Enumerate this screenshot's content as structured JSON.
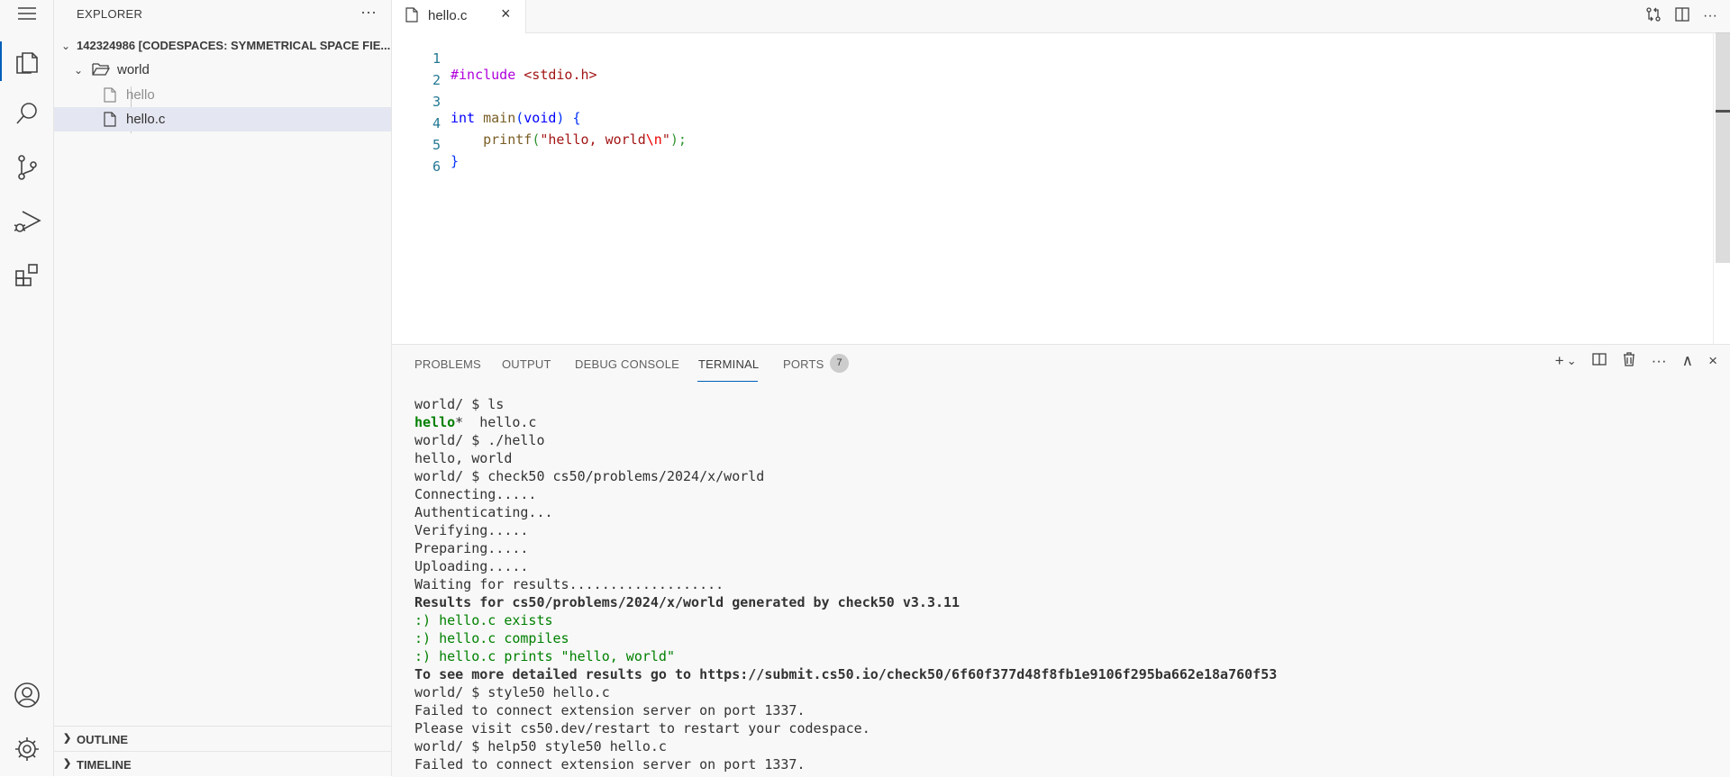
{
  "activity_bar": {
    "items": [
      "menu-icon",
      "explorer-icon",
      "search-icon",
      "source-control-icon",
      "run-debug-icon",
      "extensions-icon",
      "accounts-icon",
      "settings-gear-icon"
    ]
  },
  "sidebar": {
    "title": "EXPLORER",
    "more": "···",
    "root": "142324986 [CODESPACES: SYMMETRICAL SPACE FIE...",
    "folder": "world",
    "files": [
      "hello",
      "hello.c"
    ],
    "outline": "OUTLINE",
    "timeline": "TIMELINE"
  },
  "editor": {
    "tab_label": "hello.c",
    "close": "×",
    "line_numbers": [
      "1",
      "2",
      "3",
      "4",
      "5",
      "6"
    ],
    "code": {
      "l1_directive": "#include",
      "l1_header": " <stdio.h>",
      "l3_int": "int",
      "l3_main": " main",
      "l3_paren_open": "(",
      "l3_void": "void",
      "l3_paren_close": ")",
      "l3_brace": " {",
      "l4_indent": "    ",
      "l4_printf": "printf",
      "l4_open": "(",
      "l4_str1": "\"hello, world",
      "l4_esc": "\\n",
      "l4_str2": "\"",
      "l4_close": ");",
      "l5_brace": "}"
    }
  },
  "panel": {
    "tabs": [
      "PROBLEMS",
      "OUTPUT",
      "DEBUG CONSOLE",
      "TERMINAL",
      "PORTS"
    ],
    "ports_badge": "7",
    "actions": [
      "+",
      "⌄",
      "◫",
      "🗑",
      "···",
      "∧",
      "×"
    ],
    "terminal": {
      "l1": "world/ $ ls",
      "l2a": "hello",
      "l2b": "*  hello.c",
      "l3": "world/ $ ./hello",
      "l4": "hello, world",
      "l5": "world/ $ check50 cs50/problems/2024/x/world",
      "l6": "Connecting.....",
      "l7": "Authenticating...",
      "l8": "Verifying.....",
      "l9": "Preparing.....",
      "l10": "Uploading.....",
      "l11": "Waiting for results...................",
      "l12": "Results for cs50/problems/2024/x/world generated by check50 v3.3.11",
      "l13": ":) hello.c exists",
      "l14": ":) hello.c compiles",
      "l15": ":) hello.c prints \"hello, world\"",
      "l16": "To see more detailed results go to https://submit.cs50.io/check50/6f60f377d48f8fb1e9106f295ba662e18a760f53",
      "l17": "world/ $ style50 hello.c",
      "l18": "Failed to connect extension server on port 1337.",
      "l19": "Please visit cs50.dev/restart to restart your codespace.",
      "l20": "world/ $ help50 style50 hello.c",
      "l21": "Failed to connect extension server on port 1337."
    }
  }
}
